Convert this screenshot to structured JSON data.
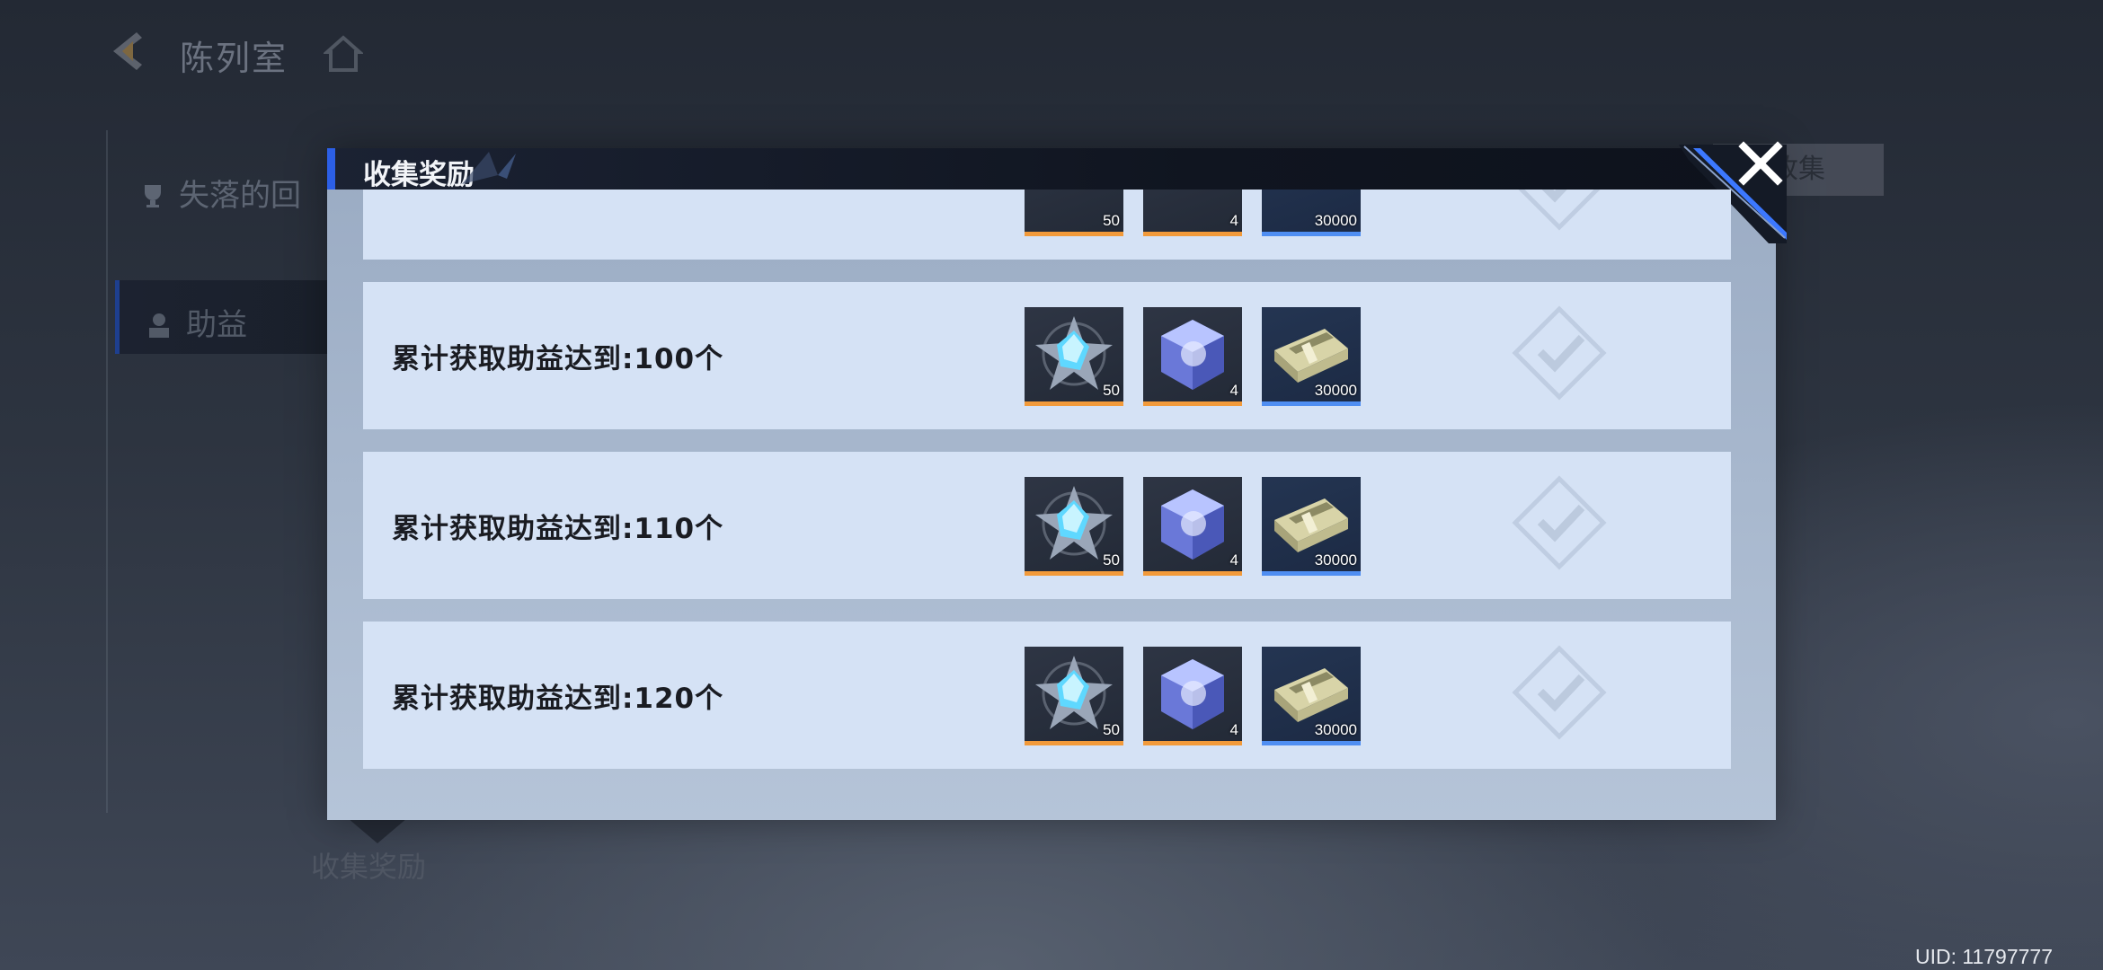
{
  "background_page": {
    "title": "陈列室",
    "tabs": [
      {
        "label": "失落的回"
      },
      {
        "label": "助益"
      }
    ],
    "right_button_label": "收集",
    "collect_label": "收集奖励",
    "uid_text": "UID: 11797777"
  },
  "modal": {
    "title": "收集奖励",
    "close_icon": "close-x",
    "partial_row": {
      "quantities": [
        "50",
        "4",
        "30000"
      ]
    },
    "rows": [
      {
        "label": "累计获取助益达到:100个",
        "rewards": [
          {
            "icon": "star-crystal-icon",
            "quantity": "50",
            "rarity_color": "#f29a3a"
          },
          {
            "icon": "cube-crystal-icon",
            "quantity": "4",
            "rarity_color": "#f29a3a"
          },
          {
            "icon": "cash-bundle-icon",
            "quantity": "30000",
            "rarity_color": "#4f8ef2"
          }
        ],
        "status": "claimed"
      },
      {
        "label": "累计获取助益达到:110个",
        "rewards": [
          {
            "icon": "star-crystal-icon",
            "quantity": "50",
            "rarity_color": "#f29a3a"
          },
          {
            "icon": "cube-crystal-icon",
            "quantity": "4",
            "rarity_color": "#f29a3a"
          },
          {
            "icon": "cash-bundle-icon",
            "quantity": "30000",
            "rarity_color": "#4f8ef2"
          }
        ],
        "status": "claimed"
      },
      {
        "label": "累计获取助益达到:120个",
        "rewards": [
          {
            "icon": "star-crystal-icon",
            "quantity": "50",
            "rarity_color": "#f29a3a"
          },
          {
            "icon": "cube-crystal-icon",
            "quantity": "4",
            "rarity_color": "#f29a3a"
          },
          {
            "icon": "cash-bundle-icon",
            "quantity": "30000",
            "rarity_color": "#4f8ef2"
          }
        ],
        "status": "claimed"
      }
    ]
  },
  "colors": {
    "accent_blue": "#2c5fe6",
    "row_background": "#d5e2f5",
    "orange_rarity": "#f29a3a",
    "blue_rarity": "#4f8ef2"
  }
}
